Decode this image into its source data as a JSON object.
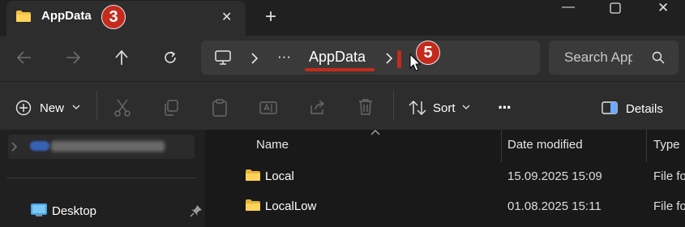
{
  "window": {
    "tab_title": "AppData",
    "new_tab_symbol": "+",
    "tab_close_symbol": "✕",
    "minimize_symbol": "—",
    "maximize_symbol": "☐",
    "close_symbol": "✕"
  },
  "annotations": {
    "step_a": "3",
    "step_b": "5",
    "accent_color": "#c42b1c"
  },
  "address": {
    "ellipsis": "···",
    "current_folder": "AppData",
    "search_placeholder": "Search AppData"
  },
  "toolbar": {
    "new_label": "New",
    "sort_label": "Sort",
    "more_label": "···",
    "details_label": "Details"
  },
  "nav_pane": {
    "items": [
      {
        "label": "Desktop",
        "pinned": true
      }
    ]
  },
  "columns": {
    "name": "Name",
    "date_modified": "Date modified",
    "type": "Type"
  },
  "files": [
    {
      "name": "Local",
      "date": "15.09.2025 15:09",
      "type": "File folder"
    },
    {
      "name": "LocalLow",
      "date": "01.08.2025 15:11",
      "type": "File folder"
    }
  ]
}
